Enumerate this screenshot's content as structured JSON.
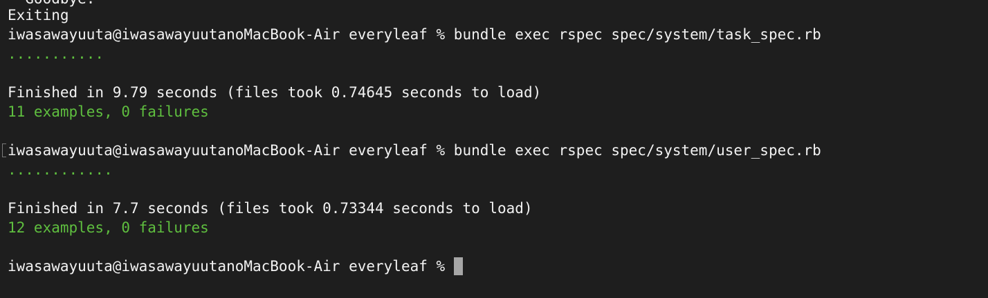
{
  "terminal": {
    "lines": {
      "goodbye_partial": "  Goodbye.",
      "exiting": "Exiting",
      "prompt1": "iwasawayuuta@iwasawayuutanoMacBook-Air everyleaf % bundle exec rspec spec/system/task_spec.rb",
      "dots1": "...........",
      "finished1": "Finished in 9.79 seconds (files took 0.74645 seconds to load)",
      "summary1": "11 examples, 0 failures",
      "prompt2": "iwasawayuuta@iwasawayuutanoMacBook-Air everyleaf % bundle exec rspec spec/system/user_spec.rb",
      "dots2": "............",
      "finished2": "Finished in 7.7 seconds (files took 0.73344 seconds to load)",
      "summary2": "12 examples, 0 failures",
      "prompt3": "iwasawayuuta@iwasawayuutanoMacBook-Air everyleaf %"
    },
    "colors": {
      "background": "#1e1e1e",
      "text": "#f2f2f2",
      "success": "#5fbf3f",
      "cursor": "#a6a6a6"
    }
  }
}
